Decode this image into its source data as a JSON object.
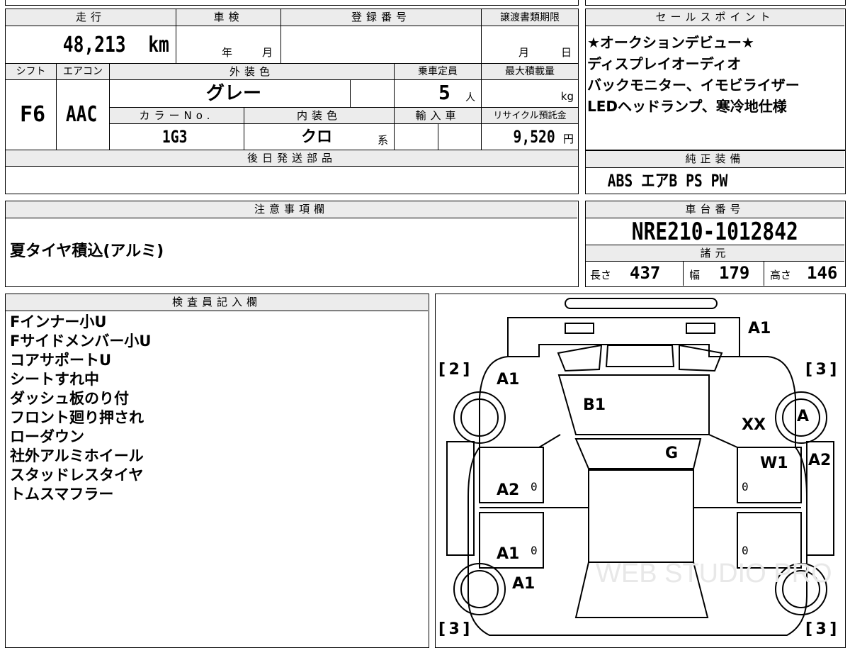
{
  "basic": {
    "mileage_label": "走行",
    "mileage_value": "48,213",
    "mileage_unit": "km",
    "shaken_label": "車検",
    "shaken_year": "年",
    "shaken_month": "月",
    "reg_label": "登録番号",
    "transfer_label": "譲渡書類期限",
    "transfer_month": "月",
    "transfer_day": "日",
    "shift_label": "シフト",
    "shift_value": "F6",
    "ac_label": "エアコン",
    "ac_value": "AAC",
    "ext_color_label": "外装色",
    "ext_color_value": "グレー",
    "capacity_label": "乗車定員",
    "capacity_value": "5",
    "capacity_unit": "人",
    "max_load_label": "最大積載量",
    "max_load_unit": "kg",
    "color_no_label": "カラーNo.",
    "color_no_value": "1G3",
    "int_color_label": "内装色",
    "int_color_value": "クロ",
    "int_color_suffix": "系",
    "import_label": "輸入車",
    "recycle_label": "リサイクル預託金",
    "recycle_value": "9,520",
    "recycle_unit": "円",
    "later_parts_label": "後日発送部品"
  },
  "sales_points": {
    "label": "セールスポイント",
    "lines": [
      "★オークションデビュー★",
      "ディスプレイオーディオ",
      "バックモニター、イモビライザー",
      "LEDヘッドランプ、寒冷地仕様"
    ]
  },
  "genuine_equipment": {
    "label": "純正装備",
    "value": "ABS エアB PS PW"
  },
  "notes": {
    "label": "注意事項欄",
    "value": "夏タイヤ積込(アルミ)"
  },
  "chassis": {
    "label": "車台番号",
    "value": "NRE210-1012842",
    "spec_label": "諸元",
    "length_label": "長さ",
    "length_value": "437",
    "width_label": "幅",
    "width_value": "179",
    "height_label": "高さ",
    "height_value": "146"
  },
  "inspector": {
    "label": "検査員記入欄",
    "lines": [
      "Fインナー小U",
      "Fサイドメンバー小U",
      "コアサポートU",
      "シートすれ中",
      "ダッシュ板のり付",
      "フロント廻り押され",
      "ローダウン",
      "社外アルミホイール",
      "スタッドレスタイヤ",
      "トムスマフラー"
    ]
  },
  "diagram": {
    "marks": {
      "front_right": "A1",
      "front_left_fender": "A1",
      "hood": "B1",
      "windshield": "G",
      "right_front_wheel": "A",
      "right_fender": "XX",
      "right_front_door": "W1",
      "right_pillar": "A2",
      "left_front_door": "A2",
      "left_rear_door": "A1",
      "left_rear": "A1"
    },
    "zeros": [
      "0",
      "0",
      "0",
      "0"
    ],
    "tread_front_left": "2",
    "tread_front_right": "3",
    "tread_rear_left": "3",
    "tread_rear_right": "3",
    "watermark": "WEB STUDIO PRO"
  }
}
